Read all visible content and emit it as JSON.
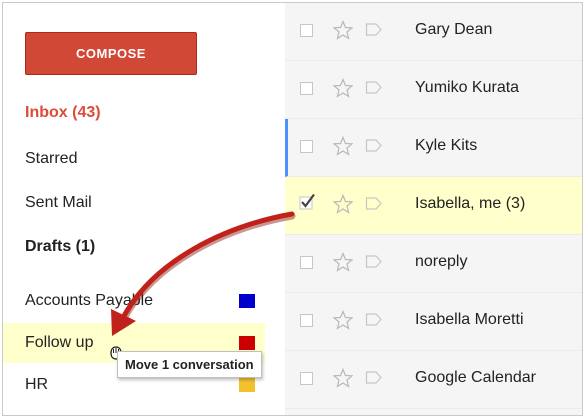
{
  "sidebar": {
    "compose_label": "COMPOSE",
    "nav": [
      {
        "label": "Inbox (43)"
      },
      {
        "label": "Starred"
      },
      {
        "label": "Sent Mail"
      },
      {
        "label": "Drafts (1)"
      }
    ],
    "labels": [
      {
        "name": "Accounts Payable",
        "color": "#0000cc"
      },
      {
        "name": "Follow up",
        "color": "#cc0000"
      },
      {
        "name": "HR",
        "color": "#f2c12e"
      }
    ]
  },
  "mail_list": {
    "rows": [
      {
        "sender": "Gary Dean"
      },
      {
        "sender": "Yumiko Kurata"
      },
      {
        "sender": "Kyle Kits"
      },
      {
        "sender": "Isabella, me (3)"
      },
      {
        "sender": "noreply"
      },
      {
        "sender": "Isabella Moretti"
      },
      {
        "sender": "Google Calendar"
      }
    ]
  },
  "drag": {
    "tooltip": "Move 1 conversation"
  },
  "colors": {
    "compose": "#d14836",
    "inbox": "#dd4b39",
    "selected_row": "#ffffcc",
    "drop_target": "#ffffcc",
    "focus_bar": "#4d90fe",
    "arrow": "#c0221b"
  }
}
